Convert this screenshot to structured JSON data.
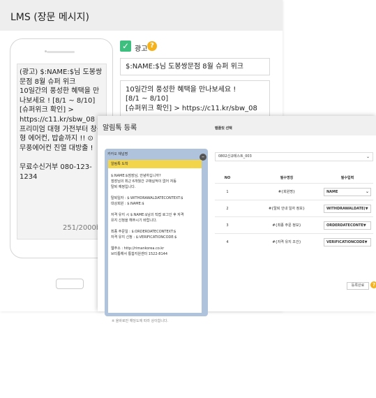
{
  "window": {
    "title": "LMS (장문 메시지)"
  },
  "phone": {
    "preview_text": "(광고) $:NAME:$님 도봉쌍문점 8월 슈퍼 위크\n10일간의 풍성한 혜택을 만나보세요 ! [8/1 ~ 8/10]\n[슈퍼위크 확인] >\nhttps://c11.kr/sbw_08 ⊙\n프리미엄 대형 가전부터 창문형 에어컨, 밥솥까지 !! ⊙\n무풍에어컨 진열 대방출 !\n\n무료수신거부 080-123-1234",
    "counter": "251/2000byte"
  },
  "ad": {
    "label": "광고",
    "checked": true
  },
  "subject": {
    "value": "$:NAME:$님 도봉쌍문점 8월 슈퍼 위크"
  },
  "body": {
    "value": "10일간의 풍성한 혜택을 만나보세요 !\n[8/1 ~ 8/10]\n[슈퍼위크 확인] > https://c11.kr/sbw_08"
  },
  "dialog": {
    "title": "알림톡 등록",
    "kakao_title": "카카오 채널명",
    "kakao_card_head": "알림톡 도착",
    "kakao_card_text": "$:NAME:$점장님, 안녕하십니까?\n점장님의 최근 6개월간 구매실적이 없어 자동\n탈퇴 예정입니다.\n\n탈퇴일자 : $:WITHDRAWALDATECONTEXT:$\n대상회원 : $:NAME:$\n\n자격 유지 시 $:NAME:$님의 직접 로그인 후 자격\n유지 신청을 해주시기 바랍니다.\n\n최종 주문일 : $:ORDERDATECONTEXT:$\n자격 유지 신청 : $:VERIFICATIONCODE:$\n\n웹주소 : http://rimankorea.co.kr\n브티통해서 통합지원센터 1522-8144",
    "kakao_note": "※ 올바로만 해당도에 따라 상이합니다.",
    "template_label": "템플릿 선택",
    "template_value": "0802신규테스트_003",
    "table": {
      "headers": [
        "NO",
        "필수명칭",
        "필수입력"
      ],
      "rows": [
        {
          "no": "1",
          "name": "#{회원명}",
          "value": "NAME"
        },
        {
          "no": "2",
          "name": "#{탈퇴 안내 일자 정보}",
          "value": "WITHDRAWALDATE(▼"
        },
        {
          "no": "3",
          "name": "#{최종 주문 정보}",
          "value": "ORDERDATECONTE▼"
        },
        {
          "no": "4",
          "name": "#{자격 유지 조건}",
          "value": "VERIFICATIONCODE▼"
        }
      ]
    },
    "confirm_label": "등록완료"
  },
  "colors": {
    "accent_green": "#3fbf7f",
    "help_orange": "#f6b21a",
    "kakao_blue": "#afc3dc",
    "kakao_yellow": "#f2d54a"
  }
}
